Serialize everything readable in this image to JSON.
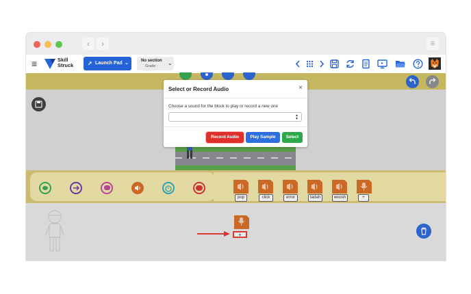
{
  "browser": {
    "back_icon": "chevron-left-icon",
    "forward_icon": "chevron-right-icon",
    "menu_icon": "menu-lines-icon"
  },
  "app": {
    "logo_line1": "Skill",
    "logo_line2": "Struck",
    "launch_pad": "Launch Pad",
    "section_name": "No section",
    "section_sub": "Grade",
    "brand_color": "#2563d9"
  },
  "dialog": {
    "title": "Select or Record Audio",
    "close": "×",
    "description": "Choose a sound for the block to play or record a new one",
    "select_value": "",
    "record_button": "Record Audio",
    "play_button": "Play Sample",
    "select_button": "Select"
  },
  "palette": {
    "event_circles": [
      {
        "name": "green-event",
        "color": "#2fa84f"
      },
      {
        "name": "arrow-event",
        "color": "#6b2fa8"
      },
      {
        "name": "speech-event",
        "color": "#c0449b"
      },
      {
        "name": "sound-event",
        "color": "#d8681c"
      },
      {
        "name": "timer-event",
        "color": "#26a8b8"
      },
      {
        "name": "stop-event",
        "color": "#d82c2c"
      }
    ],
    "sounds": [
      "pop",
      "click",
      "error",
      "tadah",
      "woosh",
      "+"
    ]
  },
  "script": {
    "new_sound_label": "+"
  }
}
